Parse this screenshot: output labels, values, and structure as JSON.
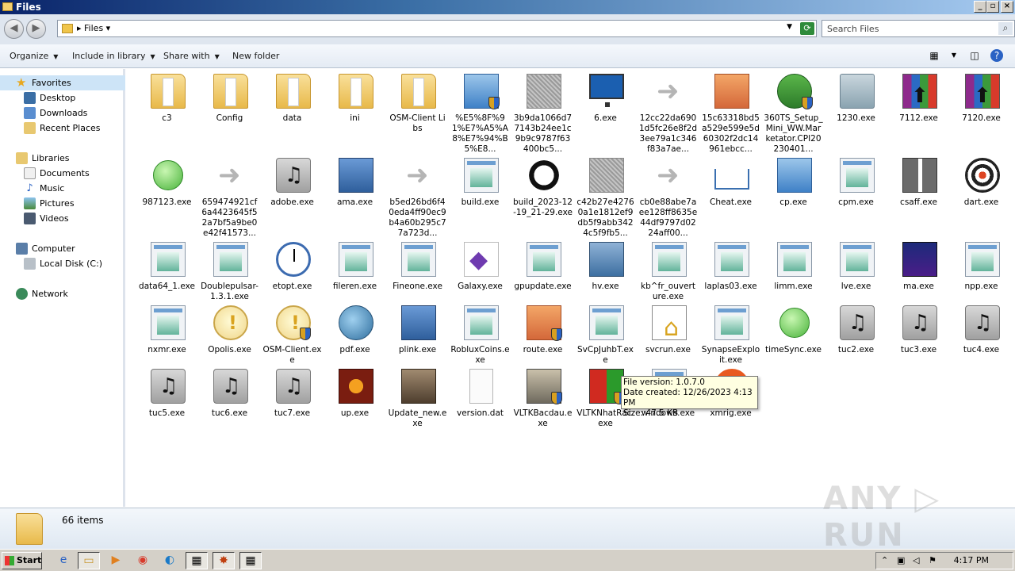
{
  "window": {
    "title": "Files"
  },
  "address": {
    "crumb": "Files",
    "search_placeholder": "Search Files"
  },
  "toolbar": {
    "organize": "Organize",
    "include_in_library": "Include in library",
    "share_with": "Share with",
    "new_folder": "New folder"
  },
  "sidebar": {
    "favorites": "Favorites",
    "desktop": "Desktop",
    "downloads": "Downloads",
    "recent_places": "Recent Places",
    "libraries": "Libraries",
    "documents": "Documents",
    "music": "Music",
    "pictures": "Pictures",
    "videos": "Videos",
    "computer": "Computer",
    "local_disk": "Local Disk (C:)",
    "network": "Network"
  },
  "files": [
    {
      "name": "c3",
      "icon": "folder-icon"
    },
    {
      "name": "Config",
      "icon": "folder-icon"
    },
    {
      "name": "data",
      "icon": "folder-icon"
    },
    {
      "name": "ini",
      "icon": "folder-icon"
    },
    {
      "name": "OSM-Client Libs",
      "icon": "folder-icon"
    },
    {
      "name": "%E5%8F%91%E7%A5%A8%E7%94%B5%E8...",
      "icon": "shield-folder-icon"
    },
    {
      "name": "3b9da1066d77143b24ee1c9b9c9787f63400bc5...",
      "icon": "gray-app-icon"
    },
    {
      "name": "6.exe",
      "icon": "monitor-icon"
    },
    {
      "name": "12cc22da6901d5fc26e8f2d3ee79a1c346f83a7ae...",
      "icon": "shortcut-icon"
    },
    {
      "name": "15c63318bd5a529e599e5d60302f2dc14961ebcc...",
      "icon": "package-icon"
    },
    {
      "name": "360TS_Setup_Mini_WW.Marketator.CPI20230401...",
      "icon": "installer-icon"
    },
    {
      "name": "1230.exe",
      "icon": "disc-icon"
    },
    {
      "name": "7112.exe",
      "icon": "rar-icon"
    },
    {
      "name": "7120.exe",
      "icon": "rar-icon"
    },
    {
      "name": "987123.exe",
      "icon": "green-orb-icon"
    },
    {
      "name": "659474921cf6a4423645f52a7bf5a9be0e42f41573...",
      "icon": "shortcut-icon"
    },
    {
      "name": "adobe.exe",
      "icon": "music-icon"
    },
    {
      "name": "ama.exe",
      "icon": "computer-icon"
    },
    {
      "name": "b5ed26bd6f40eda4ff90ec9b4a60b295c77a723d...",
      "icon": "shortcut-icon"
    },
    {
      "name": "build.exe",
      "icon": "app-icon"
    },
    {
      "name": "build_2023-12-19_21-29.exe",
      "icon": "spinner-icon"
    },
    {
      "name": "c42b27e42760a1e1812ef9db5f9abb3424c5f9fb5...",
      "icon": "gray-app-icon"
    },
    {
      "name": "cb0e88abe7aee128ff8635e44df9797d0224aff00...",
      "icon": "shortcut-icon"
    },
    {
      "name": "Cheat.exe",
      "icon": "inbox-icon"
    },
    {
      "name": "cp.exe",
      "icon": "blue-box-icon"
    },
    {
      "name": "cpm.exe",
      "icon": "app-icon"
    },
    {
      "name": "csaff.exe",
      "icon": "gift-icon"
    },
    {
      "name": "dart.exe",
      "icon": "dartboard-icon"
    },
    {
      "name": "data64_1.exe",
      "icon": "app-icon"
    },
    {
      "name": "Doublepulsar-1.3.1.exe",
      "icon": "app-icon"
    },
    {
      "name": "etopt.exe",
      "icon": "clock-icon"
    },
    {
      "name": "fileren.exe",
      "icon": "app-icon"
    },
    {
      "name": "Fineone.exe",
      "icon": "app-icon"
    },
    {
      "name": "Galaxy.exe",
      "icon": "visual-studio-icon"
    },
    {
      "name": "gpupdate.exe",
      "icon": "app-icon"
    },
    {
      "name": "hv.exe",
      "icon": "hv-icon"
    },
    {
      "name": "kb^fr_ouverture.exe",
      "icon": "app-icon"
    },
    {
      "name": "laplas03.exe",
      "icon": "app-icon"
    },
    {
      "name": "limm.exe",
      "icon": "app-icon"
    },
    {
      "name": "lve.exe",
      "icon": "app-icon"
    },
    {
      "name": "ma.exe",
      "icon": "dark-box-icon"
    },
    {
      "name": "npp.exe",
      "icon": "app-icon"
    },
    {
      "name": "nxmr.exe",
      "icon": "app-icon"
    },
    {
      "name": "Opolis.exe",
      "icon": "coin-icon"
    },
    {
      "name": "OSM-Client.exe",
      "icon": "coin-shield-icon"
    },
    {
      "name": "pdf.exe",
      "icon": "globe-icon"
    },
    {
      "name": "plink.exe",
      "icon": "network-icon"
    },
    {
      "name": "RobluxCoins.exe",
      "icon": "app-icon"
    },
    {
      "name": "route.exe",
      "icon": "package-shield-icon"
    },
    {
      "name": "SvCpJuhbT.exe",
      "icon": "app-icon"
    },
    {
      "name": "svcrun.exe",
      "icon": "house-doc-icon"
    },
    {
      "name": "SynapseExploit.exe",
      "icon": "app-icon"
    },
    {
      "name": "timeSync.exe",
      "icon": "green-orb-icon"
    },
    {
      "name": "tuc2.exe",
      "icon": "music-icon"
    },
    {
      "name": "tuc3.exe",
      "icon": "music-icon"
    },
    {
      "name": "tuc4.exe",
      "icon": "music-icon"
    },
    {
      "name": "tuc5.exe",
      "icon": "music-icon"
    },
    {
      "name": "tuc6.exe",
      "icon": "music-icon"
    },
    {
      "name": "tuc7.exe",
      "icon": "music-icon"
    },
    {
      "name": "up.exe",
      "icon": "fire-icon"
    },
    {
      "name": "Update_new.exe",
      "icon": "game-box-icon"
    },
    {
      "name": "version.dat",
      "icon": "blank-file-icon"
    },
    {
      "name": "VLTKBacdau.exe",
      "icon": "knight-icon"
    },
    {
      "name": "VLTKNhatRac.exe",
      "icon": "vltk-icon"
    },
    {
      "name": "windows.exe",
      "icon": "app-icon"
    },
    {
      "name": "xmrig.exe",
      "icon": "orange-circle-icon"
    }
  ],
  "tooltip": {
    "line1": "File version: 1.0.7.0",
    "line2": "Date created: 12/26/2023 4:13 PM",
    "line3": "Size: 47.5 KB"
  },
  "details": {
    "count": "66 items"
  },
  "watermark": "ANY ▷ RUN",
  "taskbar": {
    "start": "Start",
    "clock": "4:17 PM"
  }
}
